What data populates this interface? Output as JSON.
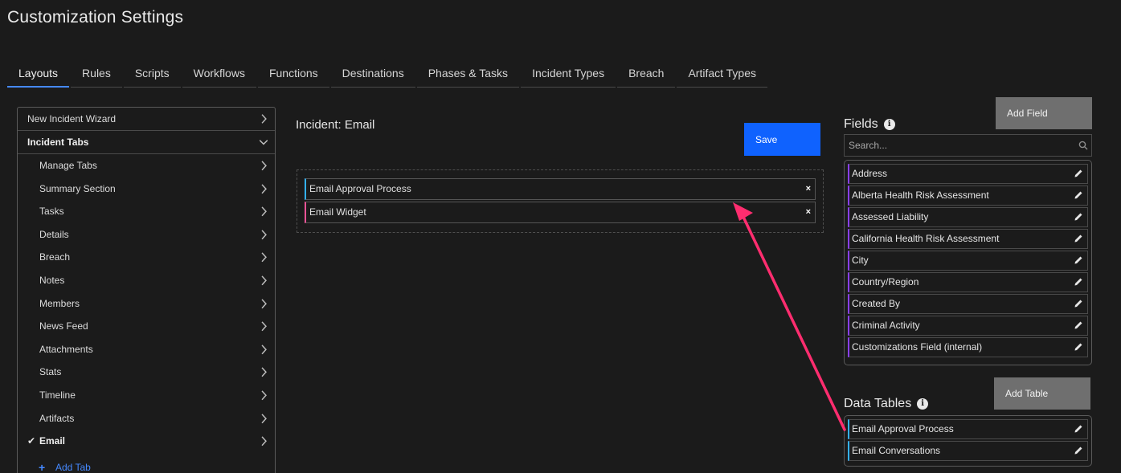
{
  "page": {
    "title": "Customization Settings"
  },
  "tabs": [
    "Layouts",
    "Rules",
    "Scripts",
    "Workflows",
    "Functions",
    "Destinations",
    "Phases & Tasks",
    "Incident Types",
    "Breach",
    "Artifact Types"
  ],
  "active_tab": "Layouts",
  "left_panel": {
    "new_incident_wizard": "New Incident Wizard",
    "incident_tabs": "Incident Tabs",
    "items": [
      "Manage Tabs",
      "Summary Section",
      "Tasks",
      "Details",
      "Breach",
      "Notes",
      "Members",
      "News Feed",
      "Attachments",
      "Stats",
      "Timeline",
      "Artifacts",
      "Email"
    ],
    "selected_item": "Email",
    "add_tab": "Add Tab"
  },
  "editor": {
    "title": "Incident: Email",
    "save_label": "Save",
    "widgets": [
      {
        "label": "Email Approval Process",
        "accent": "#33b1ff"
      },
      {
        "label": "Email Widget",
        "accent": "#ee5396"
      }
    ]
  },
  "fields": {
    "title": "Fields",
    "add_label": "Add Field",
    "search_placeholder": "Search...",
    "items": [
      "Address",
      "Alberta Health Risk Assessment",
      "Assessed Liability",
      "California Health Risk Assessment",
      "City",
      "Country/Region",
      "Created By",
      "Criminal Activity",
      "Customizations Field (internal)"
    ]
  },
  "data_tables": {
    "title": "Data Tables",
    "add_label": "Add Table",
    "items": [
      "Email Approval Process",
      "Email Conversations"
    ]
  },
  "colors": {
    "accent": "#0f62fe",
    "active_tab": "#4589ff",
    "arrow": "#ff2d6f",
    "field_accent": "#8a3ffc"
  }
}
